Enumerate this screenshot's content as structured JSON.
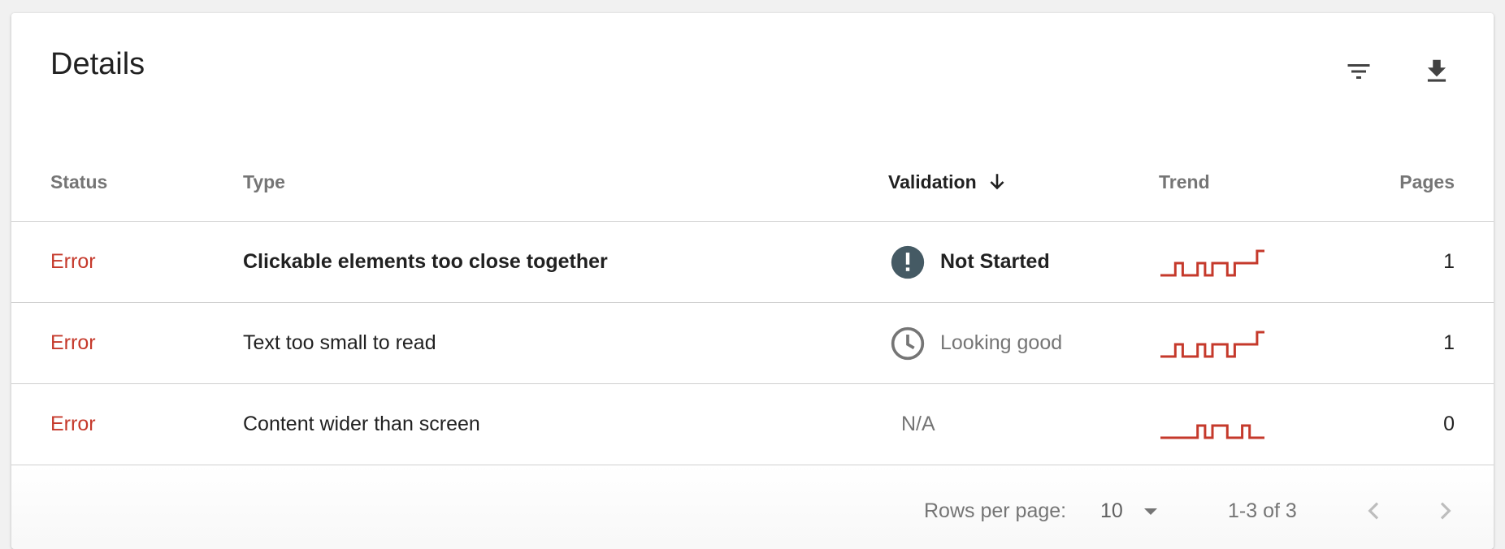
{
  "card": {
    "title": "Details"
  },
  "toolbar": {
    "filter_icon": "filter-icon",
    "download_icon": "download-icon"
  },
  "table": {
    "columns": {
      "status": "Status",
      "type": "Type",
      "validation": "Validation",
      "trend": "Trend",
      "pages": "Pages"
    },
    "sort": {
      "column": "validation",
      "direction": "descending",
      "icon": "arrow-down-icon"
    },
    "rows": [
      {
        "status": "Error",
        "type": "Clickable elements too close together",
        "type_bold": true,
        "validation": "Not Started",
        "validation_icon": "exclamation-icon",
        "trend": [
          0,
          0,
          1,
          0,
          0,
          1,
          0,
          1,
          1,
          0,
          1,
          1,
          1,
          2
        ],
        "pages": "1"
      },
      {
        "status": "Error",
        "type": "Text too small to read",
        "type_bold": false,
        "validation": "Looking good",
        "validation_icon": "clock-icon",
        "trend": [
          0,
          0,
          1,
          0,
          0,
          1,
          0,
          1,
          1,
          0,
          1,
          1,
          1,
          2
        ],
        "pages": "1"
      },
      {
        "status": "Error",
        "type": "Content wider than screen",
        "type_bold": false,
        "validation": "N/A",
        "validation_icon": "",
        "trend": [
          0,
          0,
          0,
          0,
          0,
          1,
          0,
          1,
          1,
          0,
          0,
          1,
          0,
          0
        ],
        "pages": "0"
      }
    ]
  },
  "pagination": {
    "rows_per_page_label": "Rows per page:",
    "rows_per_page_value": "10",
    "range_text": "1-3 of 3",
    "prev_icon": "chevron-left-icon",
    "next_icon": "chevron-right-icon"
  },
  "colors": {
    "error": "#c5392b",
    "trend_line": "#c5392b",
    "not_started_icon": "#455a64",
    "clock_icon": "#757575"
  }
}
